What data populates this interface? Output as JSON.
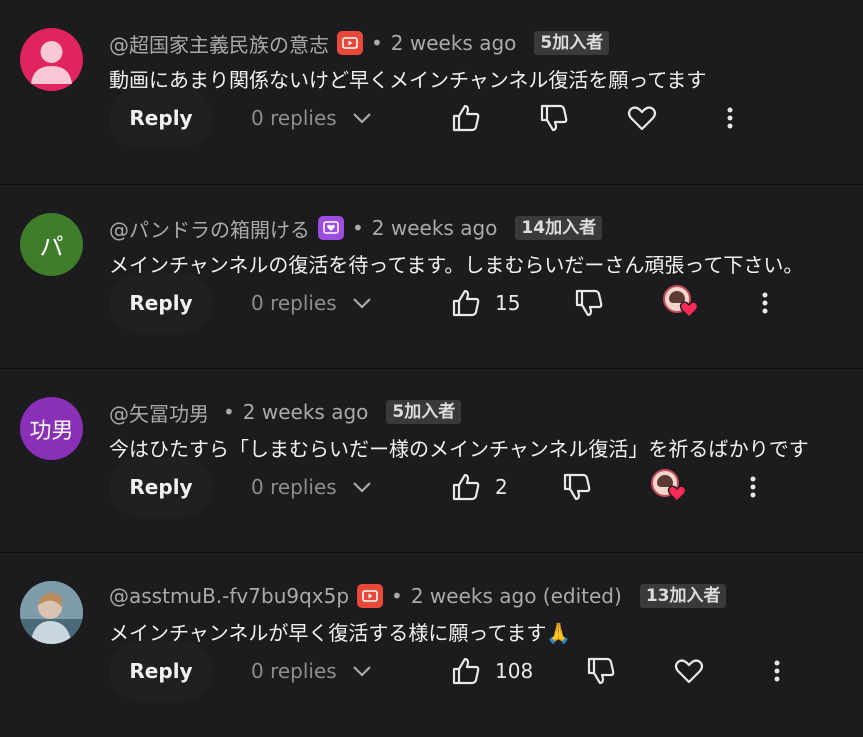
{
  "comments": [
    {
      "handle": "@超国家主義民族の意志",
      "has_badge": true,
      "badge_color": "#e8493b",
      "badge_icon": "youtube-play-icon",
      "time": "2 weeks ago",
      "member": "5加入者",
      "text": "動画にあまり関係ないけど早くメインチャンネル復活を願ってます",
      "reply_label": "Reply",
      "replies": "0 replies",
      "likes": "",
      "creator_heart": false,
      "avatar_text": "",
      "avatar_color": "#e0245e",
      "avatar_kind": "default-person"
    },
    {
      "handle": "@パンドラの箱開ける",
      "has_badge": true,
      "badge_color": "#9b4de0",
      "badge_icon": "member-heart-badge-icon",
      "time": "2 weeks ago",
      "member": "14加入者",
      "text": "メインチャンネルの復活を待ってます。しまむらいだーさん頑張って下さい。",
      "reply_label": "Reply",
      "replies": "0 replies",
      "likes": "15",
      "creator_heart": true,
      "avatar_text": "パ",
      "avatar_color": "#3f7d2a",
      "avatar_kind": "letter"
    },
    {
      "handle": "@矢冨功男",
      "has_badge": false,
      "time": "2 weeks ago",
      "member": "5加入者",
      "text": "今はひたすら「しまむらいだー様のメインチャンネル復活」を祈るばかりです",
      "reply_label": "Reply",
      "replies": "0 replies",
      "likes": "2",
      "creator_heart": true,
      "avatar_text": "功男",
      "avatar_color": "#8a2fb8",
      "avatar_kind": "letter"
    },
    {
      "handle": "@asstmuB.-fv7bu9qx5p",
      "has_badge": true,
      "badge_color": "#e8493b",
      "badge_icon": "youtube-play-icon",
      "time": "2 weeks ago (edited)",
      "member": "13加入者",
      "text": "メインチャンネルが早く復活する様に願ってます🙏",
      "reply_label": "Reply",
      "replies": "0 replies",
      "likes": "108",
      "creator_heart": false,
      "avatar_text": "",
      "avatar_color": "#6f8ea0",
      "avatar_kind": "photo"
    }
  ]
}
